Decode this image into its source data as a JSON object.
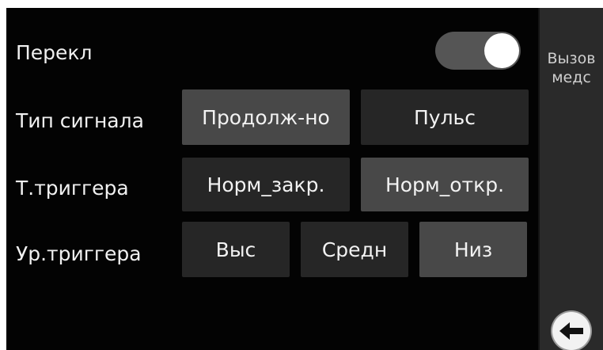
{
  "settings": {
    "rows": [
      {
        "label": "Перекл"
      },
      {
        "label": "Тип сигнала",
        "options": [
          "Продолж-но",
          "Пульс"
        ]
      },
      {
        "label": "Т.триггера",
        "options": [
          "Норм_закр.",
          "Норм_откр."
        ]
      },
      {
        "label": "Ур.триггера",
        "options": [
          "Выс",
          "Средн",
          "Низ"
        ]
      }
    ],
    "switch_on": true
  },
  "side_panel": {
    "title_line1": "Вызов",
    "title_line2": "медс"
  },
  "icons": {
    "back": "arrow-left-icon"
  },
  "colors": {
    "background": "#030303",
    "button_selected": "#484848",
    "button_unselected": "#262626",
    "text": "#f0f0f0"
  }
}
